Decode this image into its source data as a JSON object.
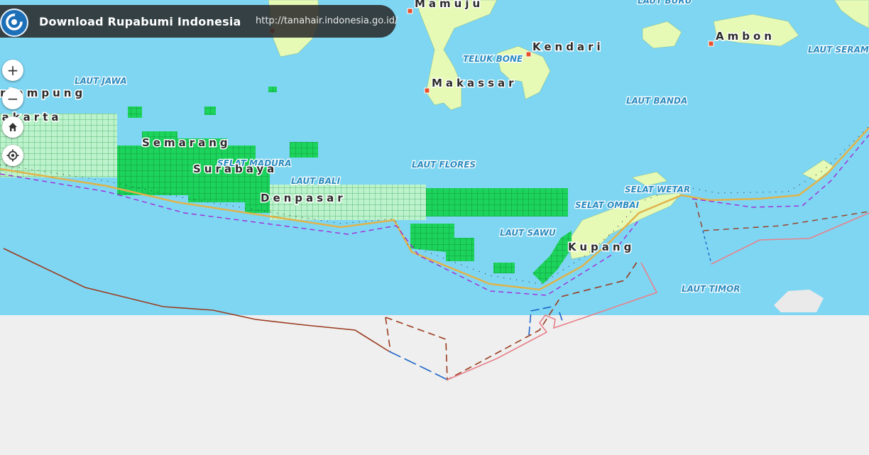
{
  "header": {
    "title": "Download Rupabumi Indonesia",
    "url": "http://tanahair.indonesia.go.id/",
    "logo_icon": "geospatial-agency-logo"
  },
  "controls": {
    "zoom_in": "+",
    "zoom_out": "−",
    "home_icon": "home-icon",
    "locate_icon": "locate-icon"
  },
  "seas": {
    "laut_buru": "LAUT BURU",
    "laut_jawa": "LAUT JAWA",
    "teluk_bone": "TELUK BONE",
    "laut_seram": "LAUT SERAM",
    "laut_banda": "LAUT BANDA",
    "selat_madura": "SELAT MADURA",
    "laut_bali": "LAUT BALI",
    "laut_flores": "LAUT FLORES",
    "selat_wetar": "SELAT WETAR",
    "selat_ombai": "SELAT OMBAI",
    "laut_sawu": "LAUT SAWU",
    "laut_timor": "LAUT TIMOR"
  },
  "cities": {
    "mamuju": "Mamuju",
    "kendari": "Kendari",
    "ambon": "Ambon",
    "makassar": "Makassar",
    "bandarlampung": "Bandarlampung",
    "jakarta": "Jakarta",
    "semarang": "Semarang",
    "surabaya": "Surabaya",
    "denpasar": "Denpasar",
    "kupang": "Kupang"
  },
  "colors": {
    "sea": "#7fd6f2",
    "land": "#e6f9b5",
    "grid_dark": "#1cd35c",
    "grid_light": "#b6f1c8",
    "boundary_brown": "#9a3b1e",
    "boundary_pink": "#e8808a",
    "boundary_blue": "#1e63c9",
    "baseline_purple": "#a32ad8",
    "coastline_yellow": "#e0b34a"
  }
}
